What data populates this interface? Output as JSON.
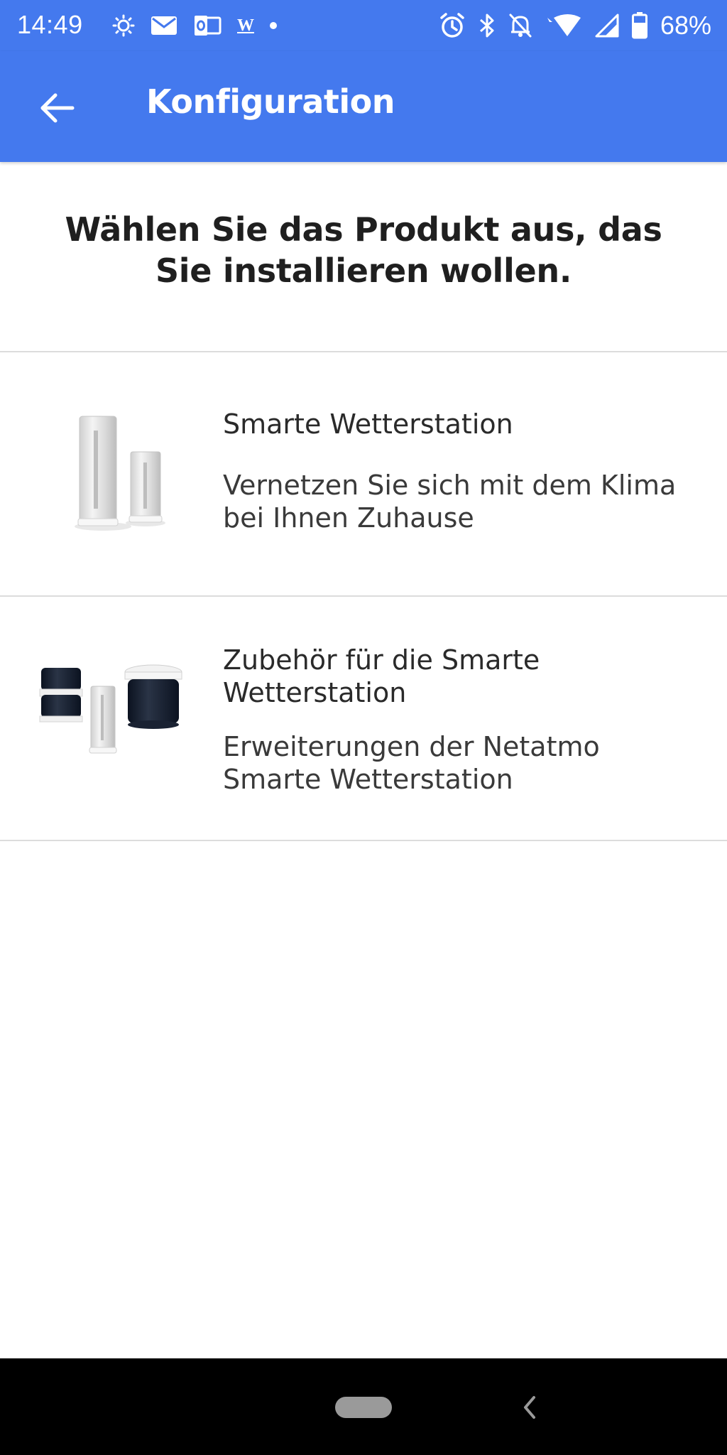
{
  "status_bar": {
    "time": "14:49",
    "left_icons": [
      "brightness-icon",
      "mail-icon",
      "outlook-icon",
      "word-icon",
      "dot-icon"
    ],
    "word_glyph": "W",
    "right_icons": [
      "alarm-icon",
      "bluetooth-icon",
      "notifications-off-icon",
      "wifi-icon",
      "signal-icon",
      "battery-icon"
    ],
    "battery": "68%",
    "battery_level": 0.68
  },
  "app_bar": {
    "title": "Konfiguration",
    "back_icon": "arrow-back-icon",
    "color": "#4479ee"
  },
  "heading": "Wählen Sie das Produkt aus, das Sie installieren wollen.",
  "products": [
    {
      "title": "Smarte Wetterstation",
      "description": "Vernetzen Sie sich mit dem Klima bei Ihnen Zuhause",
      "image": "weather-station-image"
    },
    {
      "title": "Zubehör für die Smarte Wetterstation",
      "description": "Erweiterungen der Netatmo Smarte Wetterstation",
      "image": "accessories-image"
    }
  ],
  "nav_bar": {
    "home": "home-pill",
    "back": "back-chevron-icon"
  }
}
